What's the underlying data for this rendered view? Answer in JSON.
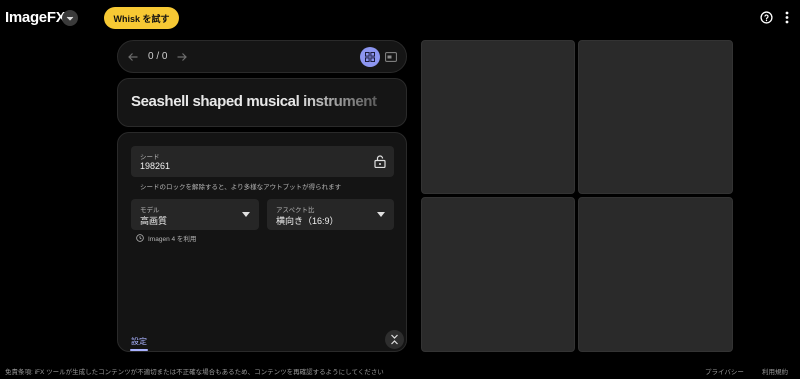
{
  "header": {
    "app_name": "ImageFX",
    "whisk_button": "Whisk を試す",
    "help_icon": "help-circle-icon",
    "more_icon": "more-vert-icon",
    "accent_color": "#f7c934"
  },
  "nav": {
    "counter": "0 / 0",
    "prev_icon": "arrow-back-icon",
    "next_icon": "arrow-forward-icon",
    "grid_view_icon": "grid-view-icon",
    "single_view_icon": "single-view-icon",
    "active_color": "#8c95f0"
  },
  "prompt": {
    "text": "Seashell shaped musical instrument"
  },
  "settings": {
    "seed": {
      "label": "シード",
      "value": "198261",
      "help": "シードのロックを解除すると、より多様なアウトプットが得られます"
    },
    "model": {
      "label": "モデル",
      "value": "高画質"
    },
    "aspect": {
      "label": "アスペクト比",
      "value": "横向き（16:9）"
    },
    "model_note": "Imagen 4 を利用",
    "tab_label": "設定"
  },
  "footer": {
    "disclaimer": "免責条項: iFX ツールが生成したコンテンツが不適切または不正確な場合もあるため、コンテンツを再確認するようにしてください",
    "privacy": "プライバシー",
    "terms": "利用規約"
  }
}
